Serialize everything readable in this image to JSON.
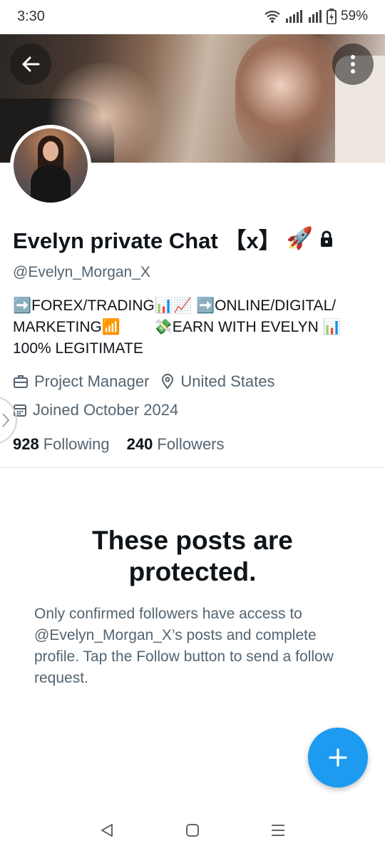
{
  "status_bar": {
    "time": "3:30",
    "battery": "59%",
    "icons": [
      "wifi-icon",
      "signal-icon",
      "signal-icon",
      "battery-charging-icon"
    ]
  },
  "header": {
    "back_icon": "arrow-left-icon",
    "more_icon": "vertical-dots-icon"
  },
  "profile": {
    "name": "Evelyn private Chat 【x】",
    "name_emoji": "🚀",
    "lock_icon": "lock-icon",
    "handle": "@Evelyn_Morgan_X",
    "bio": "➡️FOREX/TRADING📊📈 ➡️ONLINE/DIGITAL/\nMARKETING📶        💸EARN WITH EVELYN 📊\n100% LEGITIMATE",
    "job": "Project Manager",
    "location": "United States",
    "joined": "Joined October 2024",
    "following_count": "928",
    "following_label": "Following",
    "followers_count": "240",
    "followers_label": "Followers"
  },
  "protected": {
    "title": "These posts are protected.",
    "body": "Only confirmed followers have access to @Evelyn_Morgan_X’s posts and complete profile. Tap the Follow button to send a follow request."
  },
  "fab": {
    "icon": "plus-icon"
  },
  "nav": {
    "icons": [
      "back-triangle-icon",
      "home-square-icon",
      "recents-menu-icon"
    ]
  },
  "colors": {
    "accent": "#1d9bf0",
    "text": "#0f1419",
    "secondary": "#536471"
  }
}
